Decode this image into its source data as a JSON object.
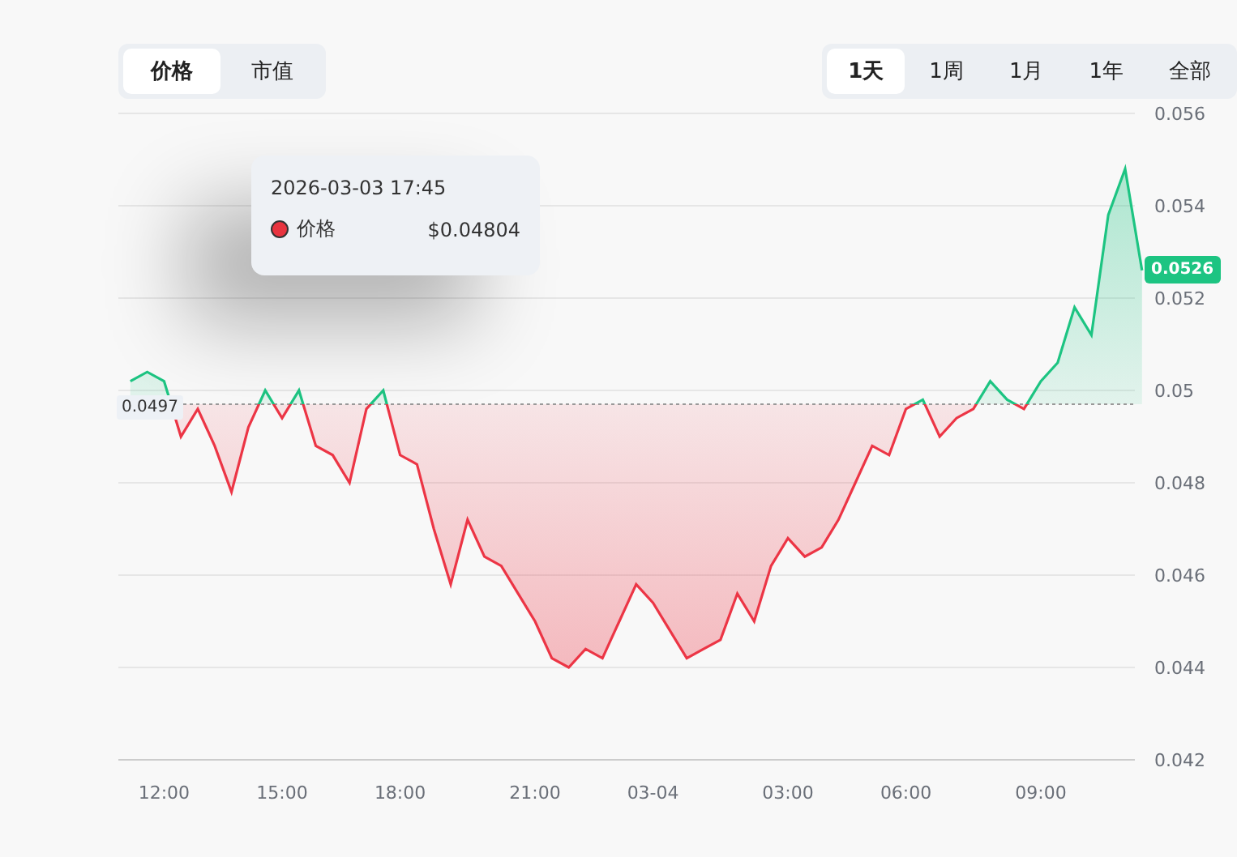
{
  "view_tabs": [
    {
      "label": "价格",
      "selected": true
    },
    {
      "label": "市值",
      "selected": false
    }
  ],
  "range_tabs": [
    {
      "label": "1天",
      "selected": true
    },
    {
      "label": "1周",
      "selected": false
    },
    {
      "label": "1月",
      "selected": false
    },
    {
      "label": "1年",
      "selected": false
    },
    {
      "label": "全部",
      "selected": false
    }
  ],
  "chart": {
    "last_price_label": "0.0526",
    "chart_data": {
      "type": "area",
      "categories": [
        null,
        null,
        "12:00",
        null,
        null,
        null,
        null,
        null,
        null,
        "15:00",
        null,
        null,
        null,
        null,
        null,
        null,
        "18:00",
        null,
        null,
        null,
        null,
        null,
        null,
        null,
        "21:00",
        null,
        null,
        null,
        null,
        null,
        null,
        "03-04",
        null,
        null,
        null,
        null,
        null,
        null,
        null,
        "03:00",
        null,
        null,
        null,
        null,
        null,
        null,
        "06:00",
        null,
        null,
        null,
        null,
        null,
        null,
        null,
        "09:00",
        null,
        null,
        null,
        null,
        null,
        null
      ],
      "series": [
        {
          "values": [
            0.0502,
            0.0504,
            0.0502,
            0.049,
            0.0496,
            0.0488,
            0.0478,
            0.0492,
            0.05,
            0.0494,
            0.05,
            0.0488,
            0.0486,
            0.048,
            0.0496,
            0.05,
            0.0486,
            0.0484,
            0.047,
            0.0458,
            0.0472,
            0.0464,
            0.0462,
            0.0456,
            0.045,
            0.0442,
            0.044,
            0.0444,
            0.0442,
            0.045,
            0.0458,
            0.0454,
            0.0448,
            0.0442,
            0.0444,
            0.0446,
            0.0456,
            0.045,
            0.0462,
            0.0468,
            0.0464,
            0.0466,
            0.0472,
            0.048,
            0.0488,
            0.0486,
            0.0496,
            0.0498,
            0.049,
            0.0494,
            0.0496,
            0.0502,
            0.0498,
            0.0496,
            0.0502,
            0.0506,
            0.0518,
            0.0512,
            0.0538,
            0.0548,
            0.0526
          ]
        }
      ],
      "ylim": [
        0.042,
        0.056
      ],
      "yticks": [
        0.042,
        0.044,
        0.046,
        0.048,
        0.05,
        0.052,
        0.054,
        0.056
      ],
      "grid": true,
      "ref_lines": [
        {
          "axis": "y",
          "value": 0.0497,
          "label": "0.0497"
        }
      ]
    }
  },
  "tooltip": {
    "time": "2026-03-03 17:45",
    "items": [
      {
        "label": "价格",
        "value": "$0.04804",
        "color": "#e8343f"
      }
    ]
  }
}
